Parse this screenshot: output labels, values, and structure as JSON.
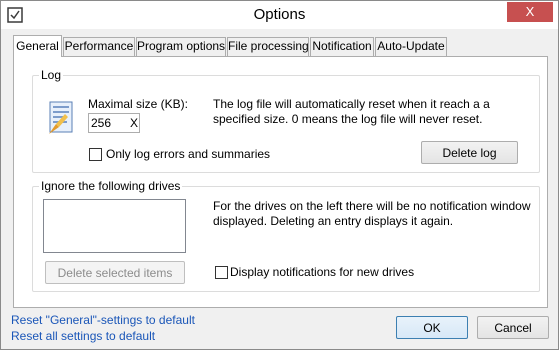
{
  "window": {
    "title": "Options",
    "close_glyph": "X"
  },
  "tabs": [
    {
      "label": "General",
      "active": true
    },
    {
      "label": "Performance",
      "active": false
    },
    {
      "label": "Program options",
      "active": false
    },
    {
      "label": "File processing",
      "active": false
    },
    {
      "label": "Notification",
      "active": false
    },
    {
      "label": "Auto-Update",
      "active": false
    }
  ],
  "log": {
    "legend": "Log",
    "max_size_label": "Maximal size (KB):",
    "max_size_value": "256",
    "clear_glyph": "X",
    "description": "The log file will automatically reset when it reach a a specified size. 0 means the log file will never reset.",
    "only_errors_label": "Only log errors and summaries",
    "only_errors_checked": false,
    "delete_button": "Delete log",
    "icon": "log-file-icon"
  },
  "drives": {
    "legend": "Ignore the following drives",
    "description": "For the drives on the left there will be no notification window displayed. Deleting an entry displays it again.",
    "delete_selected_button": "Delete selected items",
    "display_notifications_label": "Display notifications for new drives",
    "display_notifications_checked": false
  },
  "footer": {
    "reset_general_link": "Reset \"General\"-settings to default",
    "reset_all_link": "Reset all settings to default",
    "ok_button": "OK",
    "cancel_button": "Cancel"
  },
  "colors": {
    "link": "#1a56b8",
    "close_button": "#c75050",
    "primary_border": "#3c7fb1"
  }
}
